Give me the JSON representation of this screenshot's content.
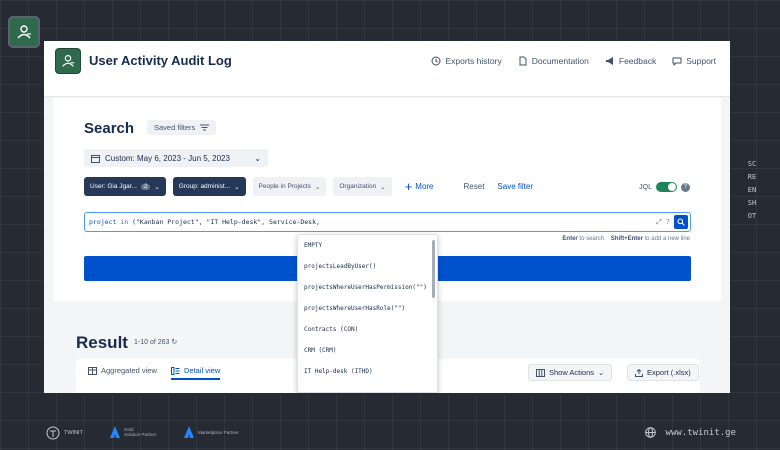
{
  "header": {
    "title": "User Activity Audit Log",
    "nav": [
      {
        "label": "Exports history",
        "icon": "history-icon"
      },
      {
        "label": "Documentation",
        "icon": "document-icon"
      },
      {
        "label": "Feedback",
        "icon": "megaphone-icon"
      },
      {
        "label": "Support",
        "icon": "chat-icon"
      }
    ]
  },
  "search": {
    "title": "Search",
    "saved_filters_label": "Saved filters",
    "date_range": "Custom: May 6, 2023 - Jun 5, 2023",
    "filters": {
      "user": "User: Gia Jgar...",
      "user_count": "2",
      "group": "Group: administ...",
      "people": "People in Projects",
      "organization": "Organization"
    },
    "more_label": "More",
    "reset_label": "Reset",
    "save_filter_label": "Save filter",
    "jql_label": "JQL",
    "jql_enabled": true,
    "query": {
      "field": "project",
      "operator": "in",
      "value": "(\"Kanban Project\", \"IT Help-desk\", Service-Desk,"
    },
    "hint_enter": "Enter",
    "hint_enter_text": "to search",
    "hint_shift": "Shift+Enter",
    "hint_shift_text": "to add a new line"
  },
  "autocomplete": {
    "items": [
      "EMPTY",
      "projectsLeadByUser()",
      "projectsWhereUserHasPermission(\"\")",
      "projectsWhereUserHasRole(\"\")",
      "Contracts (CON)",
      "CRM (CRM)",
      "IT Help-desk (ITHD)"
    ]
  },
  "result": {
    "title": "Result",
    "count": "1-10 of 263",
    "tabs": [
      {
        "label": "Aggregated view",
        "active": false
      },
      {
        "label": "Detail view",
        "active": true
      }
    ],
    "show_actions_label": "Show Actions",
    "export_label": "Export (.xlsx)"
  },
  "side_text": "SCREENSHOT",
  "footer": {
    "brand1": "TWINIT",
    "brand2_line1": "Gold",
    "brand2_line2": "Solution Partner",
    "brand3": "Marketplace Partner",
    "url": "www.twinit.ge"
  },
  "colors": {
    "primary": "#0052cc",
    "dark_chip": "#253858",
    "jql_toggle": "#1f845a",
    "logo_green": "#2f6a4c"
  }
}
